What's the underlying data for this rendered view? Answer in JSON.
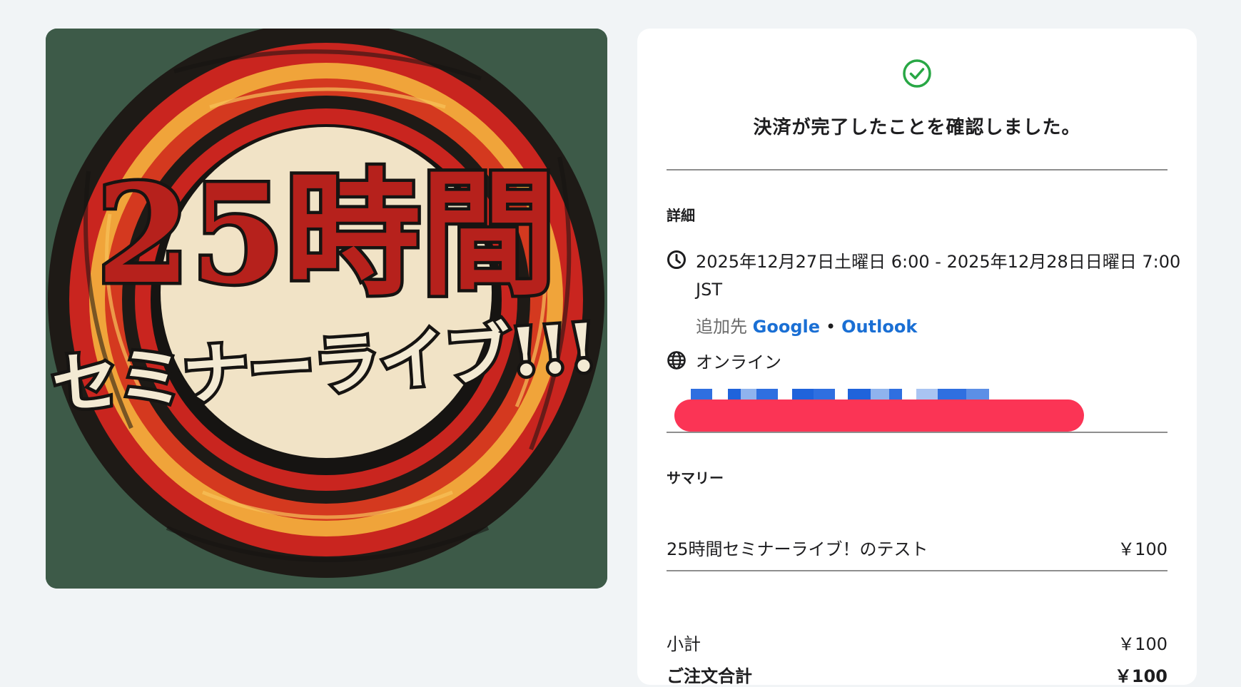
{
  "hero": {
    "title_main": "25時間",
    "title_sub": "セミナーライブ!!!",
    "colors": {
      "background": "#3d5a48",
      "ring_red": "#c9251f",
      "ring_orange": "#f0a43a",
      "center": "#f1e3c6",
      "ink": "#161412"
    }
  },
  "confirmation": {
    "icon": "check-circle-icon",
    "title": "決済が完了したことを確認しました。",
    "accent": "#28a745"
  },
  "details": {
    "label": "詳細",
    "datetime_icon": "clock-icon",
    "datetime": "2025年12月27日土曜日 6:00 - 2025年12月28日日曜日 7:00 JST",
    "add_to_label": "追加先",
    "add_to_google": "Google",
    "add_to_separator": "•",
    "add_to_outlook": "Outlook",
    "location_icon": "globe-icon",
    "location": "オンライン",
    "link_color": "#1a6fd4"
  },
  "summary": {
    "label": "サマリー",
    "item_name": "25時間セミナーライブ！のテスト",
    "item_price": "￥100",
    "subtotal_label": "小計",
    "subtotal_value": "￥100",
    "total_label": "ご注文合計",
    "total_value": "￥100"
  }
}
